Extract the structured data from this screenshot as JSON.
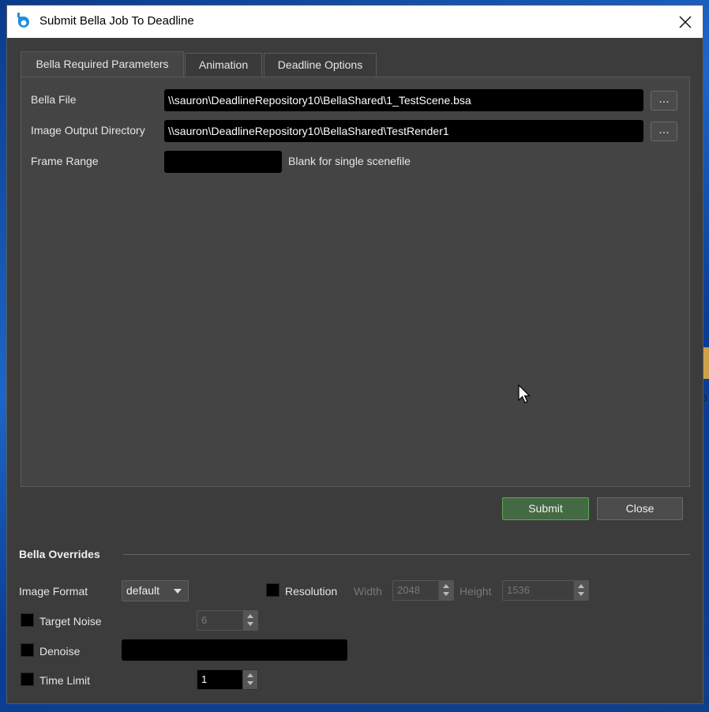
{
  "window": {
    "title": "Submit Bella Job To Deadline",
    "app_icon": "bella-app-icon",
    "close_icon": "close-icon"
  },
  "tabs": [
    {
      "label": "Bella Required Parameters",
      "active": true
    },
    {
      "label": "Animation",
      "active": false
    },
    {
      "label": "Deadline Options",
      "active": false
    }
  ],
  "params": {
    "bella_file_label": "Bella File",
    "bella_file_value": "\\\\sauron\\DeadlineRepository10\\BellaShared\\1_TestScene.bsa",
    "output_dir_label": "Image Output Directory",
    "output_dir_value": "\\\\sauron\\DeadlineRepository10\\BellaShared\\TestRender1",
    "frame_range_label": "Frame Range",
    "frame_range_value": "",
    "frame_range_hint": "Blank for single scenefile",
    "browse_label": "..."
  },
  "buttons": {
    "submit": "Submit",
    "close": "Close"
  },
  "overrides": {
    "title": "Bella Overrides",
    "image_format_label": "Image Format",
    "image_format_value": "default",
    "resolution_label": "Resolution",
    "width_label": "Width",
    "width_value": "2048",
    "height_label": "Height",
    "height_value": "1536",
    "target_noise_label": "Target Noise",
    "target_noise_value": "6",
    "denoise_label": "Denoise",
    "denoise_value": "",
    "time_limit_label": "Time Limit",
    "time_limit_value": "1"
  },
  "colors": {
    "submit_border": "#5aa85a",
    "panel_bg": "#444444",
    "window_bg": "#3c3c3c"
  }
}
